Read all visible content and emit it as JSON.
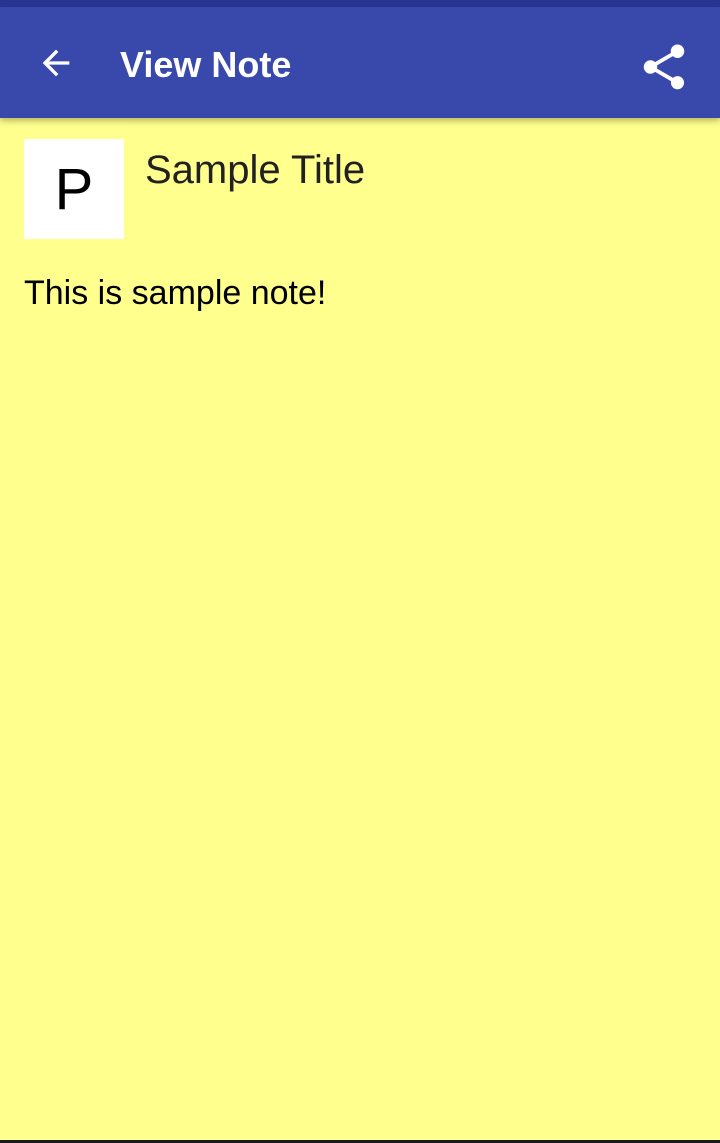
{
  "colors": {
    "status_bar": "#283593",
    "toolbar": "#3949ab",
    "note_background": "#ffff8d",
    "avatar_background": "#ffffff",
    "toolbar_text": "#ffffff"
  },
  "toolbar": {
    "back_icon": "arrow-left-icon",
    "title": "View Note",
    "share_icon": "share-icon"
  },
  "note": {
    "avatar_letter": "P",
    "title": "Sample Title",
    "body": "This is sample note!"
  }
}
